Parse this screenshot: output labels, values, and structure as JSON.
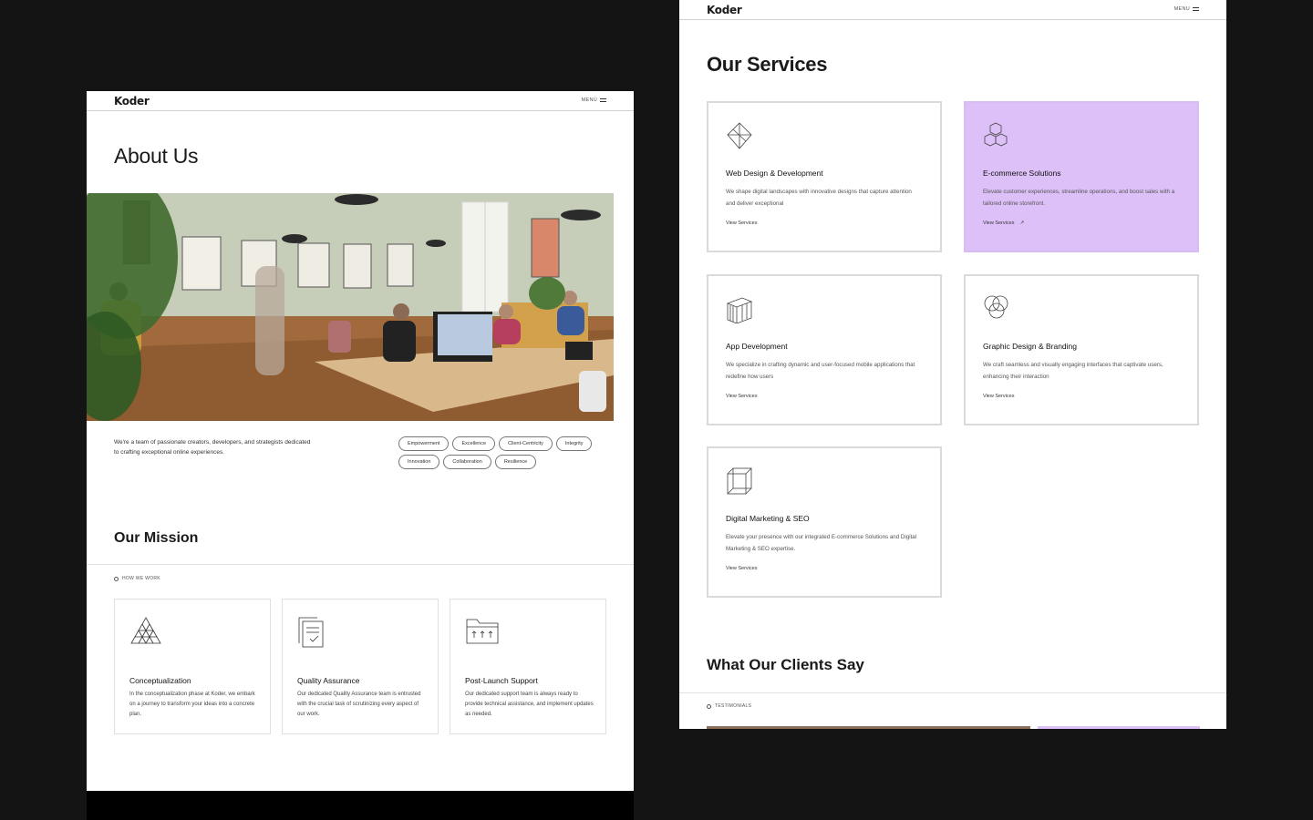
{
  "left": {
    "logo": "Koder",
    "menu": "MENU",
    "about_title": "About Us",
    "intro": "We're a team of passionate creators, developers, and strategists dedicated to crafting exceptional online experiences.",
    "values": [
      "Empowerment",
      "Excellence",
      "Client-Centricity",
      "Integrity",
      "Innovation",
      "Collaboration",
      "Resilience"
    ],
    "mission_title": "Our Mission",
    "how_we_work": "HOW WE WORK",
    "cards": [
      {
        "title": "Conceptualization",
        "desc": "In the conceptualization phase at Koder, we embark on a journey to transform your ideas into a concrete plan.",
        "icon": "triangle-grid-icon"
      },
      {
        "title": "Quality Assurance",
        "desc": "Our dedicated Quality Assurance team is entrusted with the crucial task of scrutinizing every aspect of our work.",
        "icon": "documents-check-icon"
      },
      {
        "title": "Post-Launch Support",
        "desc": "Our dedicated support team is always ready to provide technical assistance, and implement updates as needed.",
        "icon": "folder-arrows-icon"
      }
    ]
  },
  "right": {
    "logo": "Koder",
    "menu": "MENU",
    "services_title": "Our Services",
    "services": [
      {
        "title": "Web Design & Development",
        "desc": "We shape digital landscapes with innovative designs that capture attention and deliver exceptional",
        "link": "View Services",
        "icon": "diamond-icon",
        "active": false
      },
      {
        "title": "E-commerce Solutions",
        "desc": "Elevate customer experiences, streamline operations, and boost sales with a tailored online storefront.",
        "link": "View Services",
        "arrow": "↗",
        "icon": "cubes-icon",
        "active": true
      },
      {
        "title": "App Development",
        "desc": "We specialize in crafting dynamic and user-focused mobile applications that redefine how users",
        "link": "View Services",
        "icon": "stacked-books-icon",
        "active": false
      },
      {
        "title": "Graphic Design & Branding",
        "desc": "We craft seamless and visually engaging interfaces that captivate users, enhancing their interaction",
        "link": "View Services",
        "icon": "overlapping-circles-icon",
        "active": false
      },
      {
        "title": "Digital Marketing & SEO",
        "desc": "Elevate your presence with our integrated E-commerce Solutions and Digital Marketing & SEO expertise.",
        "link": "View Services",
        "icon": "cube-icon",
        "active": false
      }
    ],
    "clients_title": "What Our Clients Say",
    "testimonials": "TESTIMONIALS"
  },
  "colors": {
    "active_card": "#dcc0f7",
    "page_bg": "#141414"
  }
}
